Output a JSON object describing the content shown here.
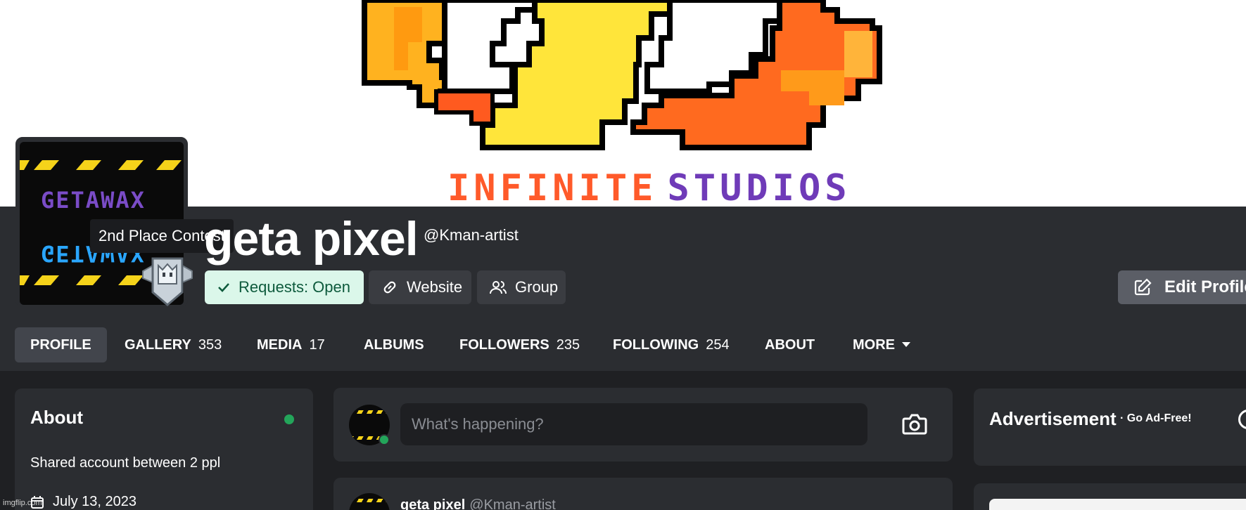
{
  "banner": {
    "word1": "INFINITE",
    "word2": "STUDIOS"
  },
  "avatar": {
    "line1": "GETAWAX",
    "line2": "GETAWAX"
  },
  "tooltip": "2nd Place Contest",
  "profile": {
    "display_name": "geta pixel",
    "username": "@Kman-artist"
  },
  "chips": {
    "requests": "Requests: Open",
    "website": "Website",
    "group": "Group"
  },
  "edit_label": "Edit Profile",
  "tabs": [
    {
      "label": "PROFILE",
      "count": ""
    },
    {
      "label": "GALLERY",
      "count": "353"
    },
    {
      "label": "MEDIA",
      "count": "17"
    },
    {
      "label": "ALBUMS",
      "count": ""
    },
    {
      "label": "FOLLOWERS",
      "count": "235"
    },
    {
      "label": "FOLLOWING",
      "count": "254"
    },
    {
      "label": "ABOUT",
      "count": ""
    },
    {
      "label": "MORE",
      "count": ""
    }
  ],
  "about": {
    "title": "About",
    "bio": "Shared account between 2 ppl",
    "date": "July 13, 2023"
  },
  "composer": {
    "placeholder": "What's happening?"
  },
  "post": {
    "name": "geta pixel",
    "handle": "@Kman-artist"
  },
  "ad": {
    "title": "Advertisement",
    "adfree": "· Go Ad-Free!"
  },
  "watermark": "imgflip.com",
  "colors": {
    "accent_orange": "#ff5a2a",
    "accent_purple": "#6f3bb8",
    "online_green": "#23a55a",
    "requests_bg": "#dbf7ea"
  }
}
